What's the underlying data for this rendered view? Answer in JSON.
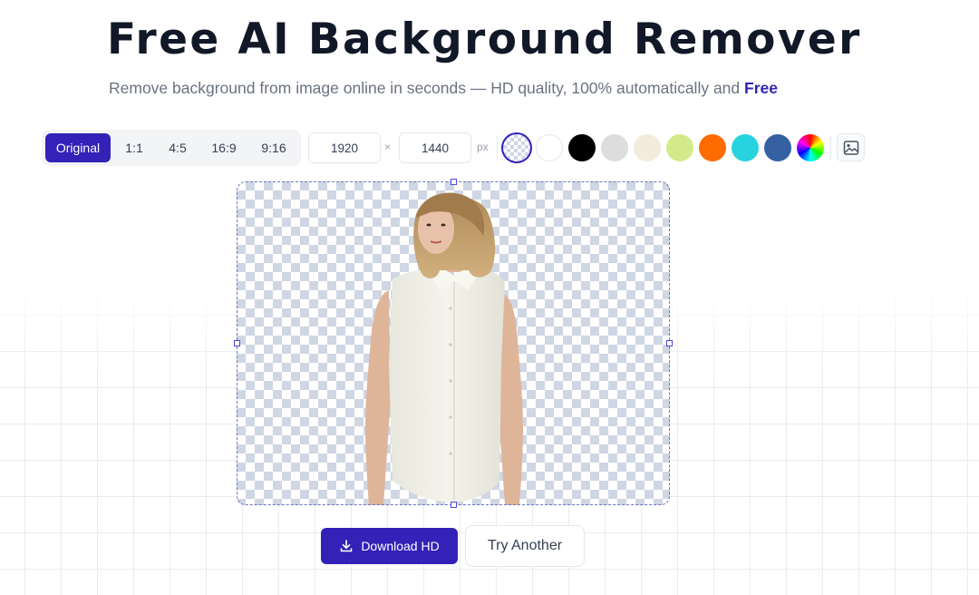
{
  "header": {
    "title": "Free AI Background Remover",
    "subtitle": "Remove background from image online in seconds — HD quality, 100% automatically and",
    "subtitle_highlight": "Free"
  },
  "toolbar": {
    "ratios": [
      {
        "label": "Original",
        "active": true
      },
      {
        "label": "1:1",
        "active": false
      },
      {
        "label": "4:5",
        "active": false
      },
      {
        "label": "16:9",
        "active": false
      },
      {
        "label": "9:16",
        "active": false
      }
    ],
    "width_value": "1920",
    "height_value": "1440",
    "times_symbol": "×",
    "unit": "px",
    "swatches": [
      {
        "name": "transparent",
        "color": "transparent",
        "selected": true
      },
      {
        "name": "white",
        "color": "#ffffff",
        "selected": false
      },
      {
        "name": "black",
        "color": "#000000",
        "selected": false
      },
      {
        "name": "light-gray",
        "color": "#dddddd",
        "selected": false
      },
      {
        "name": "cream",
        "color": "#f3ecdd",
        "selected": false
      },
      {
        "name": "lime",
        "color": "#d3ea8b",
        "selected": false
      },
      {
        "name": "orange",
        "color": "#ff6b00",
        "selected": false
      },
      {
        "name": "cyan",
        "color": "#26d3df",
        "selected": false
      },
      {
        "name": "blue",
        "color": "#3560a2",
        "selected": false
      },
      {
        "name": "custom",
        "color": "rainbow",
        "selected": false
      }
    ],
    "upload_icon": "image-icon"
  },
  "actions": {
    "download_label": "Download HD",
    "download_icon": "download-icon",
    "try_another_label": "Try Another"
  },
  "colors": {
    "accent": "#3321b8",
    "title": "#111827",
    "muted": "#6b7280"
  }
}
